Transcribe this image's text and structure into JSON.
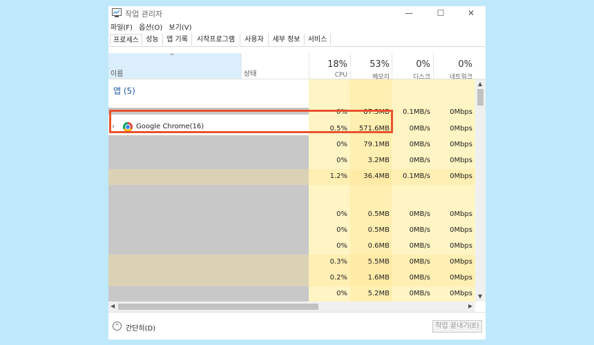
{
  "window": {
    "title": "작업 관리자",
    "controls": {
      "minimize": "—",
      "maximize": "☐",
      "close": "✕"
    }
  },
  "menu": [
    "파일(F)",
    "옵션(O)",
    "보기(V)"
  ],
  "tabs": [
    "프로세스",
    "성능",
    "앱 기록",
    "시작프로그램",
    "사용자",
    "세부 정보",
    "서비스"
  ],
  "header": {
    "sort_caret": "^",
    "name": "이름",
    "status": "상태",
    "cpu": {
      "pct": "18%",
      "label": "CPU"
    },
    "memory": {
      "pct": "53%",
      "label": "메모리"
    },
    "disk": {
      "pct": "0%",
      "label": "디스크"
    },
    "network": {
      "pct": "0%",
      "label": "네트워크"
    }
  },
  "group_label": "앱 (5)",
  "rows": [
    {
      "cpu": "0%",
      "mem": "87.5MB",
      "disk": "0.1MB/s",
      "net": "0Mbps"
    },
    {
      "name": "Google Chrome(16)",
      "cpu": "0.5%",
      "mem": "571.6MB",
      "disk": "0MB/s",
      "net": "0Mbps"
    },
    {
      "cpu": "0%",
      "mem": "79.1MB",
      "disk": "0MB/s",
      "net": "0Mbps"
    },
    {
      "cpu": "0%",
      "mem": "3.2MB",
      "disk": "0MB/s",
      "net": "0Mbps"
    },
    {
      "cpu": "1.2%",
      "mem": "36.4MB",
      "disk": "0.1MB/s",
      "net": "0Mbps"
    },
    {
      "cpu": "0%",
      "mem": "0.5MB",
      "disk": "0MB/s",
      "net": "0Mbps"
    },
    {
      "cpu": "0%",
      "mem": "0.5MB",
      "disk": "0MB/s",
      "net": "0Mbps"
    },
    {
      "cpu": "0%",
      "mem": "0.6MB",
      "disk": "0MB/s",
      "net": "0Mbps"
    },
    {
      "cpu": "0.3%",
      "mem": "5.5MB",
      "disk": "0MB/s",
      "net": "0Mbps"
    },
    {
      "cpu": "0.2%",
      "mem": "1.6MB",
      "disk": "0MB/s",
      "net": "0Mbps"
    },
    {
      "cpu": "0%",
      "mem": "5.2MB",
      "disk": "0MB/s",
      "net": "0Mbps"
    }
  ],
  "footer": {
    "collapse_icon": "^",
    "collapse_label": "간단히(D)",
    "end_task": "작업 끝내기(E)"
  },
  "colors": {
    "highlight": "#e8522f",
    "cpu_shade": "#fff4c4",
    "mem_shade": "#ffefb0",
    "group": "#1e5aa8"
  }
}
